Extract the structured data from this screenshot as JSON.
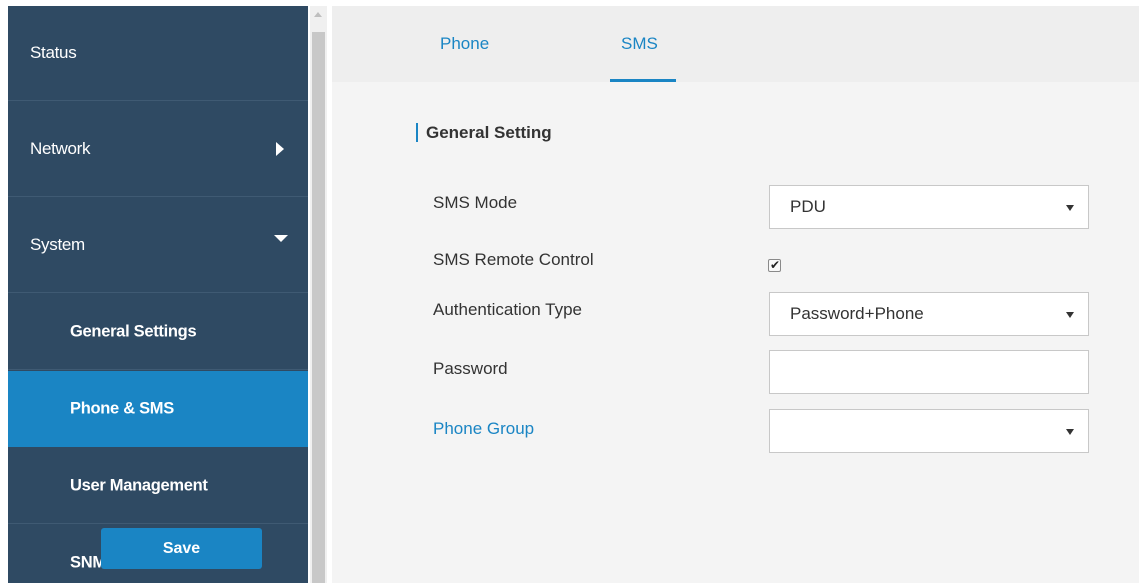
{
  "sidebar": {
    "items": [
      {
        "label": "Status"
      },
      {
        "label": "Network"
      },
      {
        "label": "System"
      },
      {
        "label": "General Settings"
      },
      {
        "label": "Phone & SMS"
      },
      {
        "label": "User Management"
      },
      {
        "label": "SNMP"
      }
    ]
  },
  "tabs": {
    "phone": "Phone",
    "sms": "SMS",
    "active": "SMS"
  },
  "section": {
    "title": "General Setting"
  },
  "form": {
    "sms_mode_label": "SMS Mode",
    "sms_mode_value": "PDU",
    "remote_control_label": "SMS Remote Control",
    "remote_control_checked": true,
    "auth_type_label": "Authentication Type",
    "auth_type_value": "Password+Phone",
    "password_label": "Password",
    "password_value": "",
    "phone_group_label": "Phone Group",
    "phone_group_value": ""
  },
  "buttons": {
    "save": "Save"
  },
  "colors": {
    "sidebar_bg": "#2f4a63",
    "accent": "#1a85c4",
    "content_bg": "#f4f4f4"
  },
  "icons": {
    "network_caret": "chevron-right-icon",
    "system_caret": "chevron-down-icon",
    "check": "checkmark-icon"
  }
}
